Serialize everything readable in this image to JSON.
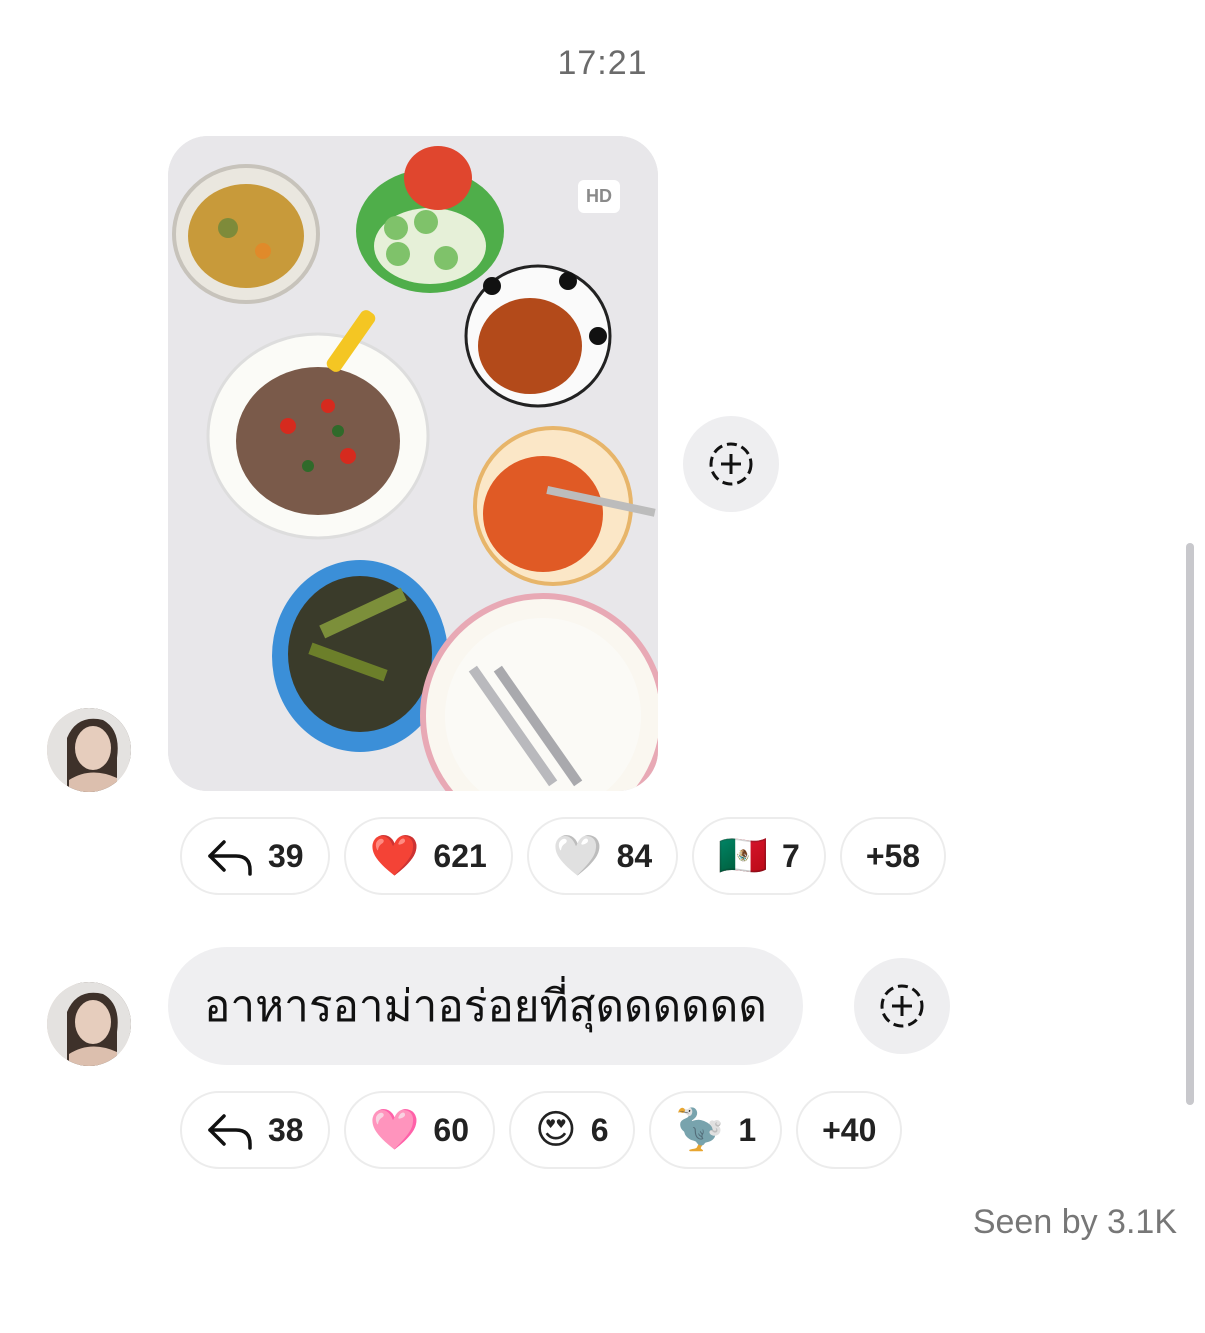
{
  "timestamp": "17:21",
  "message1": {
    "type": "photo",
    "badge": "HD",
    "reactions": [
      {
        "icon": "reply-arrow-icon",
        "emoji": "",
        "count": "39"
      },
      {
        "icon": "red-heart-icon",
        "emoji": "❤️",
        "count": "621"
      },
      {
        "icon": "white-heart-icon",
        "emoji": "🤍",
        "count": "84"
      },
      {
        "icon": "mexico-flag-icon",
        "emoji": "🇲🇽",
        "count": "7"
      },
      {
        "icon": "",
        "emoji": "",
        "count": "+58"
      }
    ]
  },
  "message2": {
    "text": "อาหารอาม่าอร่อยที่สุดดดดดด",
    "reactions": [
      {
        "icon": "reply-arrow-icon",
        "emoji": "",
        "count": "38"
      },
      {
        "icon": "pink-heart-icon",
        "emoji": "🩷",
        "count": "60"
      },
      {
        "icon": "heart-eyes-icon",
        "emoji": "😍",
        "count": "6"
      },
      {
        "icon": "dodo-icon",
        "emoji": "🦤",
        "count": "1"
      },
      {
        "icon": "",
        "emoji": "",
        "count": "+40"
      }
    ]
  },
  "seen_by": "Seen by 3.1K"
}
